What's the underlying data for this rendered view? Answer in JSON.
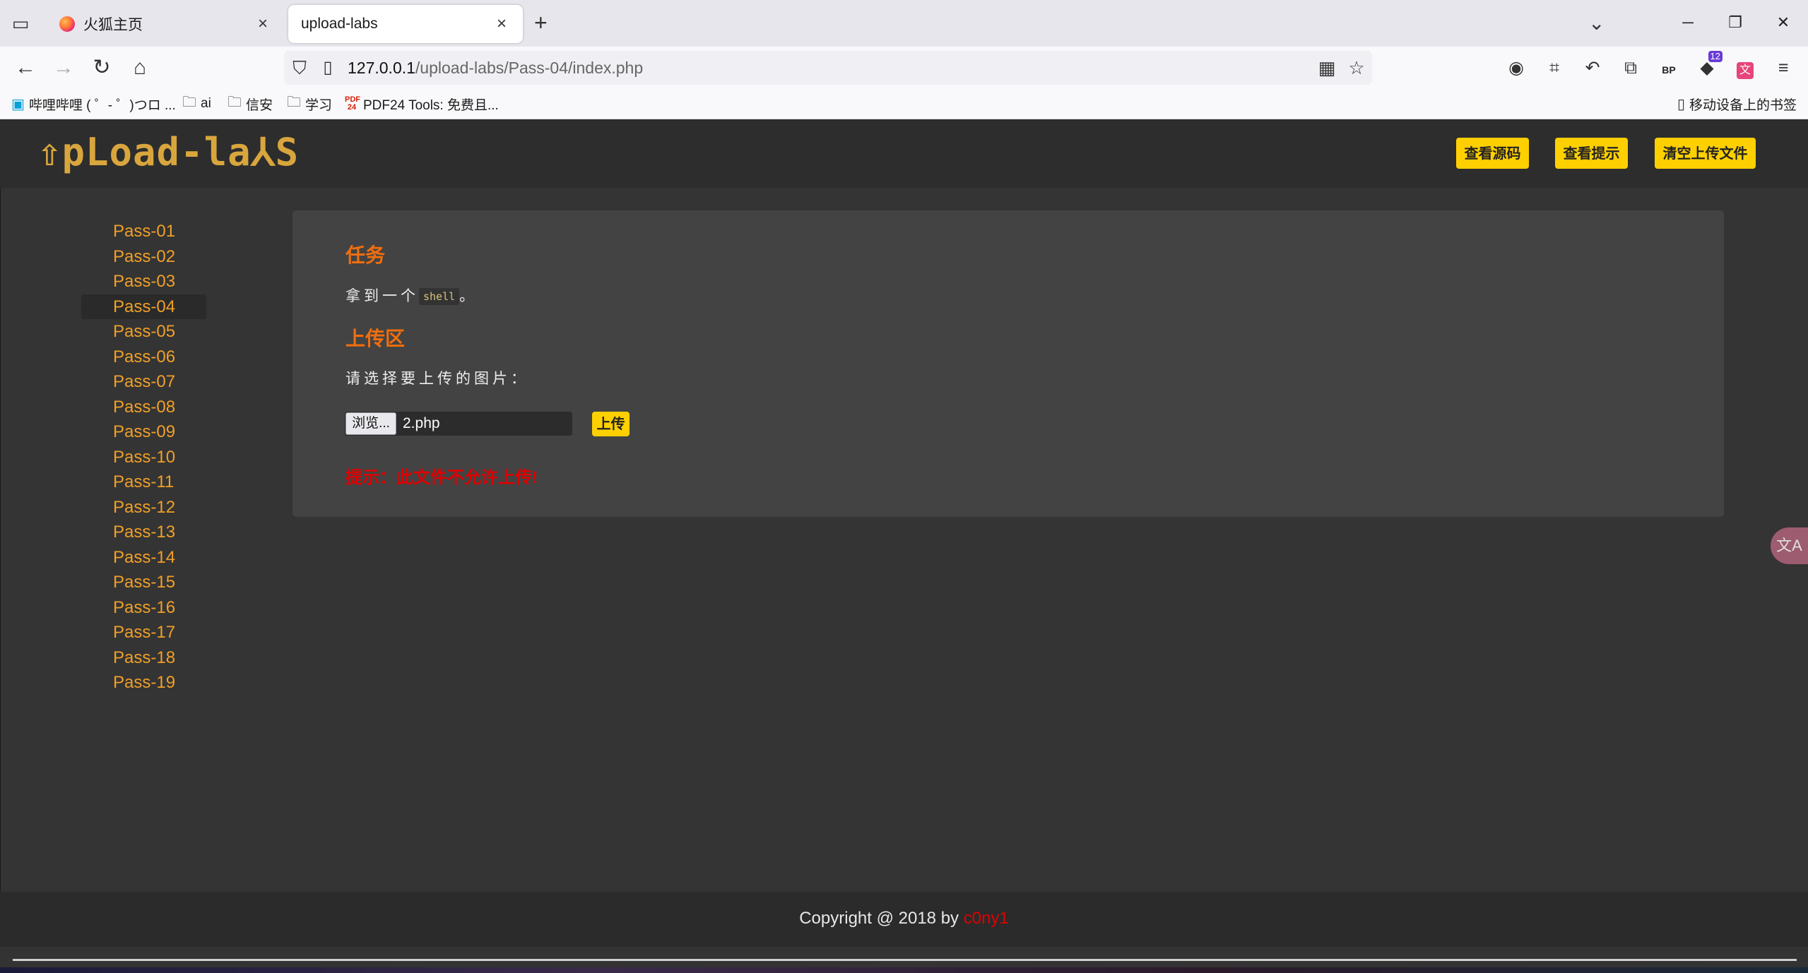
{
  "browser": {
    "tabs": [
      {
        "title": "火狐主页",
        "active": false
      },
      {
        "title": "upload-labs",
        "active": true
      }
    ],
    "url": {
      "host": "127.0.0.1",
      "path": "/upload-labs/Pass-04/index.php"
    },
    "bookmarks": [
      {
        "label": "哔哩哔哩 ( ゜- ゜)つロ ..."
      },
      {
        "label": "ai"
      },
      {
        "label": "信安"
      },
      {
        "label": "学习"
      },
      {
        "label": "PDF24 Tools: 免费且..."
      }
    ],
    "mobile_bookmarks": "移动设备上的书签",
    "extension_badges": {
      "bp": "BP",
      "count": "12",
      "translate": "文"
    }
  },
  "site": {
    "logo": "⇧pLoad-la⅄S",
    "header_buttons": [
      "查看源码",
      "查看提示",
      "清空上传文件"
    ],
    "sidebar": [
      "Pass-01",
      "Pass-02",
      "Pass-03",
      "Pass-04",
      "Pass-05",
      "Pass-06",
      "Pass-07",
      "Pass-08",
      "Pass-09",
      "Pass-10",
      "Pass-11",
      "Pass-12",
      "Pass-13",
      "Pass-14",
      "Pass-15",
      "Pass-16",
      "Pass-17",
      "Pass-18",
      "Pass-19"
    ],
    "active_pass": "Pass-04",
    "task": {
      "heading": "任务",
      "text_before": "拿到一个",
      "code": "shell",
      "text_after": "。"
    },
    "upload": {
      "heading": "上传区",
      "prompt": "请选择要上传的图片：",
      "browse_label": "浏览...",
      "file_name": "2.php",
      "submit_label": "上传",
      "message": "提示：此文件不允许上传!"
    },
    "translate_fab": "文A",
    "footer": {
      "prefix": "Copyright @ 2018 by ",
      "author": "c0ny1"
    }
  }
}
